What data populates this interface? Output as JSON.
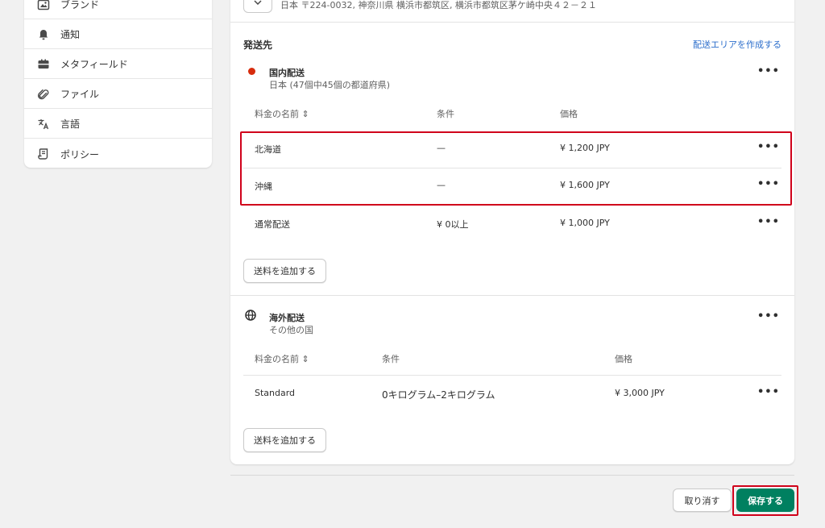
{
  "sidebar": {
    "items": [
      {
        "label": "ブランド",
        "icon": "brand-icon"
      },
      {
        "label": "通知",
        "icon": "bell-icon"
      },
      {
        "label": "メタフィールド",
        "icon": "metafield-icon"
      },
      {
        "label": "ファイル",
        "icon": "paperclip-icon"
      },
      {
        "label": "言語",
        "icon": "translate-icon"
      },
      {
        "label": "ポリシー",
        "icon": "policy-icon"
      }
    ]
  },
  "origin": {
    "address": "日本 〒224-0032, 神奈川県 横浜市都筑区, 横浜市都筑区茅ケ崎中央４２－２１"
  },
  "shipping": {
    "title": "発送先",
    "create_zone_link": "配送エリアを作成する",
    "domestic": {
      "name": "国内配送",
      "subtitle": "日本 (47個中45個の都道府県)",
      "columns": {
        "name": "料金の名前 ⇕",
        "condition": "条件",
        "price": "価格"
      },
      "rates": [
        {
          "name": "北海道",
          "condition": "—",
          "price": "¥ 1,200 JPY"
        },
        {
          "name": "沖縄",
          "condition": "—",
          "price": "¥ 1,600 JPY"
        },
        {
          "name": "通常配送",
          "condition": "¥ 0以上",
          "price": "¥ 1,000 JPY"
        }
      ],
      "add_rate": "送料を追加する"
    },
    "international": {
      "name": "海外配送",
      "subtitle": "その他の国",
      "columns": {
        "name": "料金の名前 ⇕",
        "condition": "条件",
        "price": "価格"
      },
      "rates": [
        {
          "name": "Standard",
          "condition": "0キログラム–2キログラム",
          "price": "¥ 3,000 JPY"
        }
      ],
      "add_rate": "送料を追加する"
    },
    "more_menu": "•••"
  },
  "footer": {
    "cancel": "取り消す",
    "save": "保存する"
  },
  "colors": {
    "primary": "#008060",
    "link": "#2c6ecb",
    "highlight": "#d0021b",
    "domestic_dot": "#d72c0d"
  }
}
